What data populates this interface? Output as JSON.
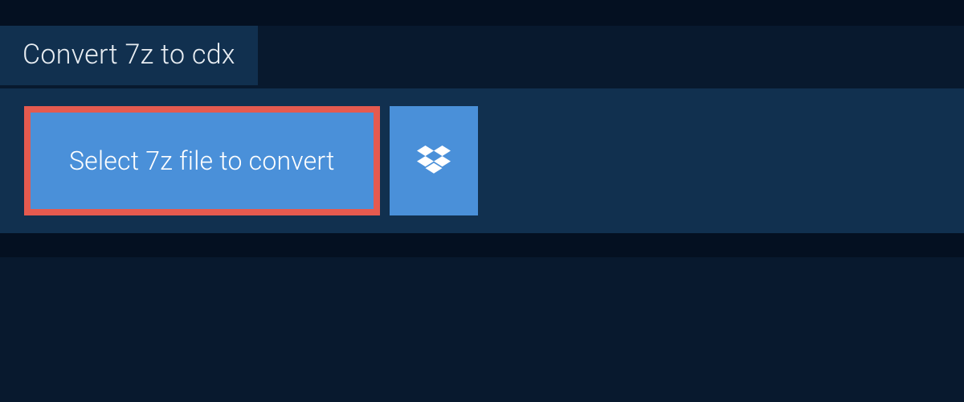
{
  "tab": {
    "title": "Convert 7z to cdx"
  },
  "actions": {
    "select_label": "Select 7z file to convert",
    "dropbox_icon": "dropbox-icon"
  }
}
